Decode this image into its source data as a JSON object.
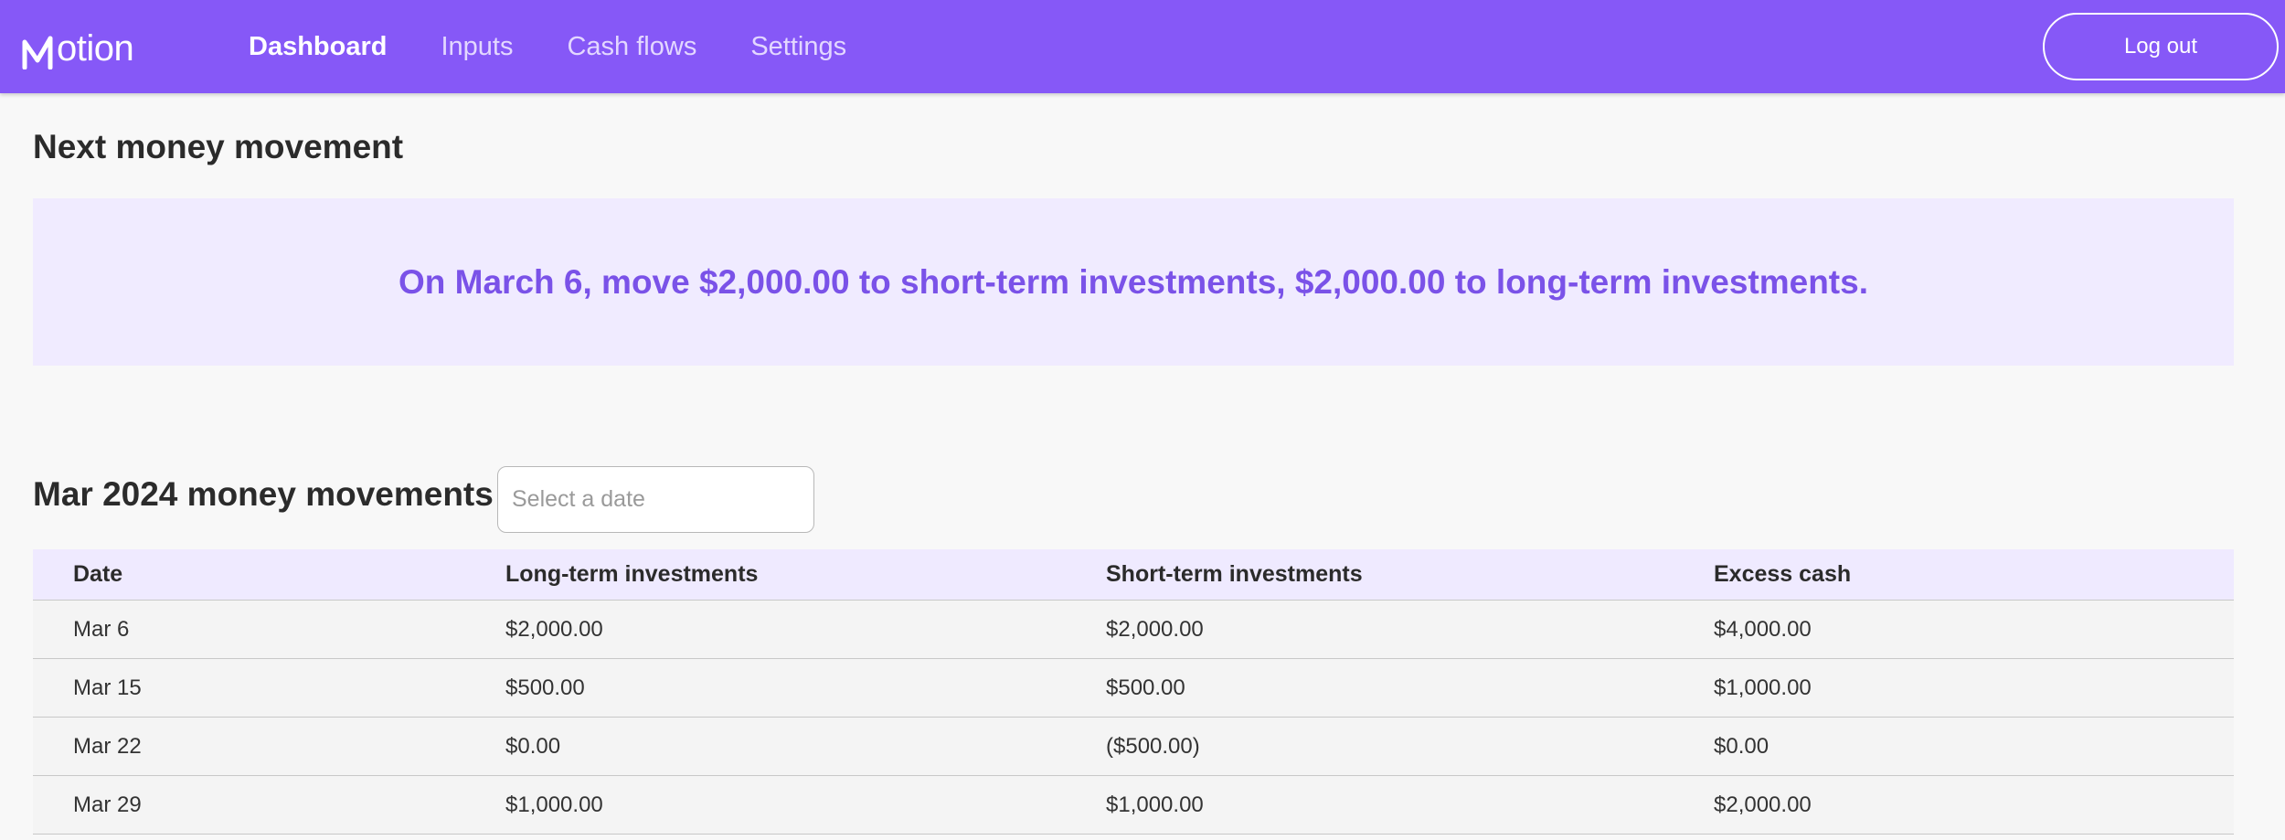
{
  "app": {
    "logo_text": "otion",
    "logo_full": "Motion",
    "accent_color": "#8658f7"
  },
  "nav": {
    "links": [
      {
        "label": "Dashboard",
        "active": true
      },
      {
        "label": "Inputs",
        "active": false
      },
      {
        "label": "Cash flows",
        "active": false
      },
      {
        "label": "Settings",
        "active": false
      }
    ],
    "logout_label": "Log out"
  },
  "next_movement": {
    "title": "Next money movement",
    "message": "On March 6, move $2,000.00 to short-term investments, $2,000.00 to long-term investments."
  },
  "movements": {
    "title": "Mar 2024 money movements",
    "date_placeholder": "Select a date",
    "date_value": "",
    "columns": [
      "Date",
      "Long-term investments",
      "Short-term investments",
      "Excess cash"
    ],
    "rows": [
      [
        "Mar 6",
        "$2,000.00",
        "$2,000.00",
        "$4,000.00"
      ],
      [
        "Mar 15",
        "$500.00",
        "$500.00",
        "$1,000.00"
      ],
      [
        "Mar 22",
        "$0.00",
        "($500.00)",
        "$0.00"
      ],
      [
        "Mar 29",
        "$1,000.00",
        "$1,000.00",
        "$2,000.00"
      ]
    ]
  }
}
